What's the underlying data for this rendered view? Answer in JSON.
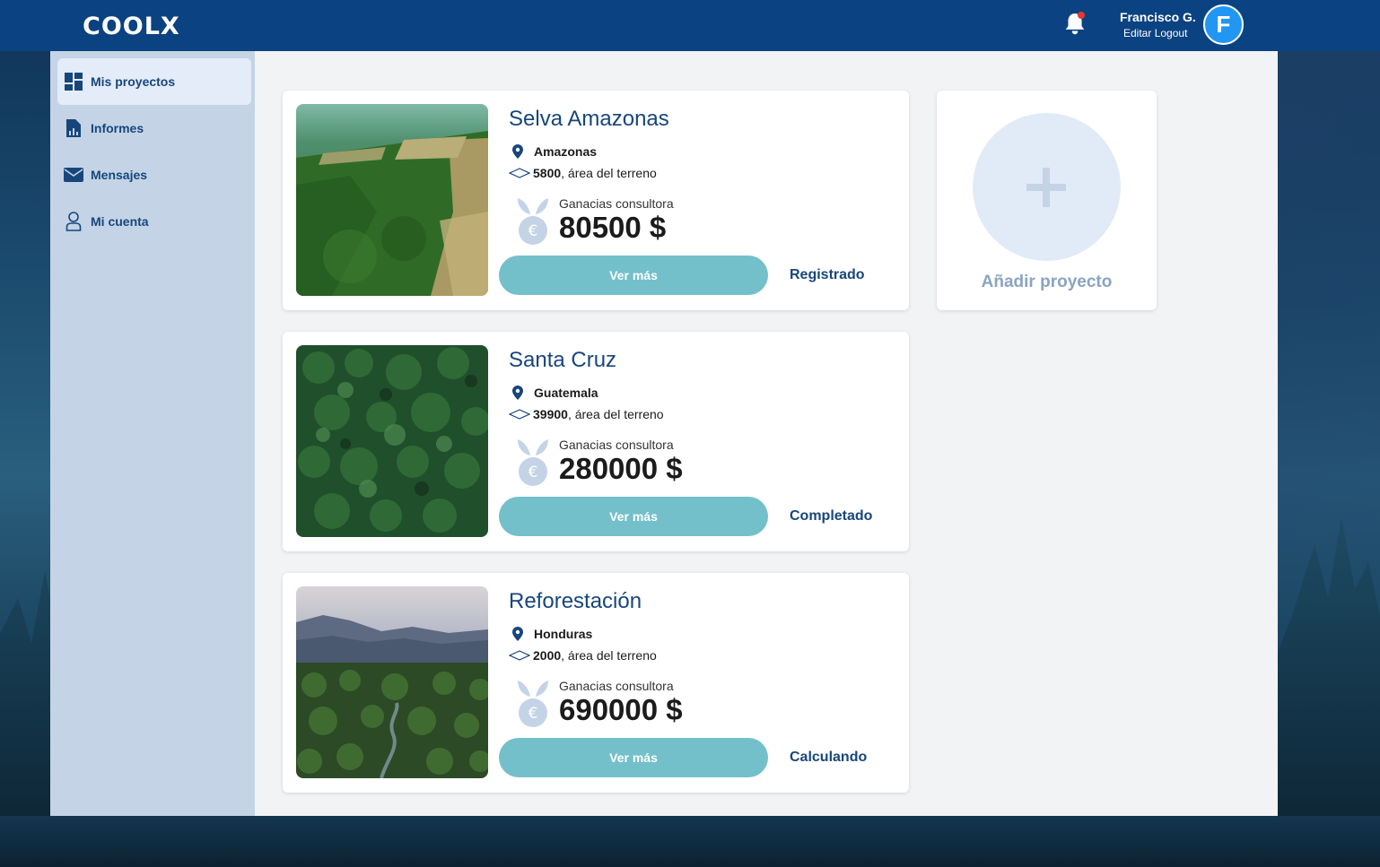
{
  "header": {
    "logo": "COOLX",
    "user_name": "Francisco G.",
    "edit_label": "Editar",
    "logout_label": "Logout",
    "avatar_letter": "F"
  },
  "sidebar": {
    "items": [
      {
        "label": "Mis proyectos",
        "icon": "dashboard-icon",
        "active": true
      },
      {
        "label": "Informes",
        "icon": "report-icon",
        "active": false
      },
      {
        "label": "Mensajes",
        "icon": "mail-icon",
        "active": false
      },
      {
        "label": "Mi cuenta",
        "icon": "user-icon",
        "active": false
      }
    ]
  },
  "projects": [
    {
      "title": "Selva Amazonas",
      "location": "Amazonas",
      "area": "5800",
      "area_suffix": ", área del terreno",
      "earnings_label": "Ganacias consultora",
      "earnings": "80500 $",
      "button": "Ver más",
      "status": "Registrado",
      "image": "deforested-forest-aerial"
    },
    {
      "title": "Santa Cruz",
      "location": "Guatemala",
      "area": "39900",
      "area_suffix": ", área del terreno",
      "earnings_label": "Ganacias consultora",
      "earnings": "280000 $",
      "button": "Ver más",
      "status": "Completado",
      "image": "dense-forest-aerial"
    },
    {
      "title": "Reforestación",
      "location": "Honduras",
      "area": "2000",
      "area_suffix": ", área del terreno",
      "earnings_label": "Ganacias consultora",
      "earnings": "690000 $",
      "button": "Ver más",
      "status": "Calculando",
      "image": "mountain-rainforest"
    }
  ],
  "add_project": {
    "label": "Añadir proyecto"
  },
  "colors": {
    "topbar": "#0b4281",
    "sidebar": "#c4d4e6",
    "primary_text": "#17467c",
    "button": "#73c0cb",
    "avatar": "#2196f3"
  }
}
